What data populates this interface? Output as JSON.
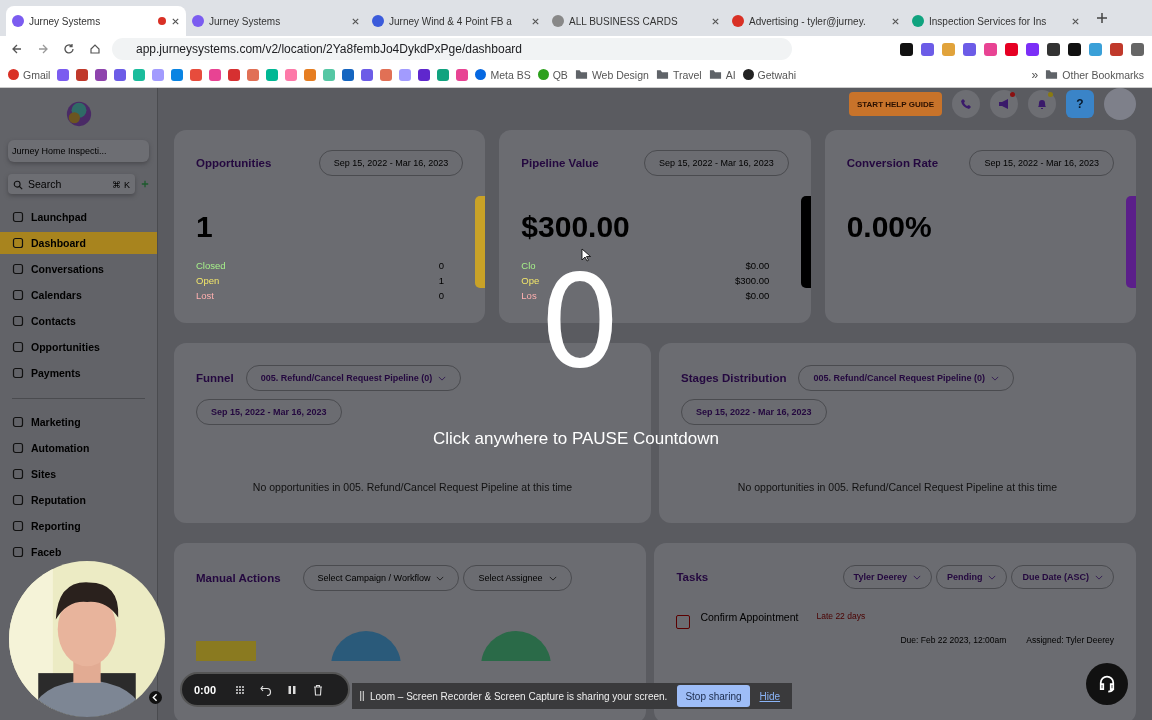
{
  "browser": {
    "tabs": [
      {
        "title": "Jurney Systems",
        "selected": true,
        "recording": true,
        "color": "#7b5cf0"
      },
      {
        "title": "Jurney Systems",
        "selected": false,
        "recording": false,
        "color": "#7b5cf0"
      },
      {
        "title": "Jurney Wind & 4 Point FB a",
        "selected": false,
        "recording": false,
        "color": "#3b5bdb"
      },
      {
        "title": "ALL BUSINESS CARDS",
        "selected": false,
        "recording": false,
        "color": "#888888"
      },
      {
        "title": "Advertising - tyler@jurney.",
        "selected": false,
        "recording": false,
        "color": "#d93025"
      },
      {
        "title": "Inspection Services for Ins",
        "selected": false,
        "recording": false,
        "color": "#10a37f"
      }
    ],
    "url": "app.jurneysystems.com/v2/location/2Ya8fembJo4DykdPxPge/dashboard",
    "extensions": [
      {
        "color": "#111111"
      },
      {
        "color": "#6c5ce7"
      },
      {
        "color": "#e1a33b"
      },
      {
        "color": "#6c5ce7"
      },
      {
        "color": "#e84393"
      },
      {
        "color": "#e60023"
      },
      {
        "color": "#7b2ff7"
      },
      {
        "color": "#333333"
      },
      {
        "color": "#111111"
      },
      {
        "color": "#3aa0d8"
      },
      {
        "color": "#c0392b"
      },
      {
        "color": "#666666"
      }
    ],
    "bookmarks": [
      {
        "kind": "site",
        "label": "Gmail",
        "color": "#d93025"
      },
      {
        "kind": "icon",
        "color": "#7b5cf0"
      },
      {
        "kind": "icon",
        "color": "#c0392b"
      },
      {
        "kind": "icon",
        "color": "#8e44ad"
      },
      {
        "kind": "icon",
        "color": "#6c5ce7"
      },
      {
        "kind": "icon",
        "color": "#1abc9c"
      },
      {
        "kind": "icon",
        "color": "#a29bfe"
      },
      {
        "kind": "icon",
        "color": "#0984e3"
      },
      {
        "kind": "icon",
        "color": "#e74c3c"
      },
      {
        "kind": "icon",
        "color": "#e84393"
      },
      {
        "kind": "icon",
        "color": "#d63031"
      },
      {
        "kind": "icon",
        "color": "#e17055"
      },
      {
        "kind": "icon",
        "color": "#00b894"
      },
      {
        "kind": "icon",
        "color": "#fd79a8"
      },
      {
        "kind": "icon",
        "color": "#e67e22"
      },
      {
        "kind": "icon",
        "color": "#55c7a4"
      },
      {
        "kind": "icon",
        "color": "#1565c0"
      },
      {
        "kind": "icon",
        "color": "#6c5ce7"
      },
      {
        "kind": "icon",
        "color": "#e17055"
      },
      {
        "kind": "icon",
        "color": "#a29bfe"
      },
      {
        "kind": "icon",
        "color": "#5f27cd"
      },
      {
        "kind": "icon",
        "color": "#10a37f"
      },
      {
        "kind": "icon",
        "color": "#e84393"
      },
      {
        "kind": "site",
        "label": "Meta BS",
        "color": "#0668e1"
      },
      {
        "kind": "site",
        "label": "QB",
        "color": "#2ca01c"
      },
      {
        "kind": "folder",
        "label": "Web Design",
        "color": "#5f6368"
      },
      {
        "kind": "folder",
        "label": "Travel",
        "color": "#5f6368"
      },
      {
        "kind": "folder",
        "label": "AI",
        "color": "#5f6368"
      },
      {
        "kind": "site",
        "label": "Getwahi",
        "color": "#222222"
      }
    ],
    "more": "»",
    "other_bookmarks": "Other Bookmarks"
  },
  "sidebar": {
    "account": "Jurney Home Inspecti...",
    "search": {
      "placeholder": "Search",
      "shortcut": "⌘ K"
    },
    "groups": [
      [
        {
          "label": "Launchpad",
          "selected": false
        },
        {
          "label": "Dashboard",
          "selected": true
        },
        {
          "label": "Conversations",
          "selected": false
        },
        {
          "label": "Calendars",
          "selected": false
        },
        {
          "label": "Contacts",
          "selected": false
        },
        {
          "label": "Opportunities",
          "selected": false
        },
        {
          "label": "Payments",
          "selected": false
        }
      ],
      [
        {
          "label": "Marketing",
          "selected": false
        },
        {
          "label": "Automation",
          "selected": false
        },
        {
          "label": "Sites",
          "selected": false
        },
        {
          "label": "Reputation",
          "selected": false
        },
        {
          "label": "Reporting",
          "selected": false
        },
        {
          "label": "Faceb",
          "selected": false
        }
      ]
    ]
  },
  "header": {
    "help_guide": "START HELP GUIDE",
    "help": "?"
  },
  "stat_cards": [
    {
      "title": "Opportunities",
      "date_range": "Sep 15, 2022 - Mar 16, 2023",
      "value": "1",
      "color": "#c9a227",
      "breakdown": [
        {
          "label": "Closed",
          "value": "0"
        },
        {
          "label": "Open",
          "value": "1"
        },
        {
          "label": "Lost",
          "value": "0"
        }
      ]
    },
    {
      "title": "Pipeline Value",
      "date_range": "Sep 15, 2022 - Mar 16, 2023",
      "value": "$300.00",
      "color": "#000000",
      "breakdown": [
        {
          "label": "Clo",
          "value": "$0.00"
        },
        {
          "label": "Ope",
          "value": "$300.00"
        },
        {
          "label": "Los",
          "value": "$0.00"
        }
      ]
    },
    {
      "title": "Conversion Rate",
      "date_range": "Sep 15, 2022 - Mar 16, 2023",
      "value": "0.00%",
      "color": "#5b1f8a"
    }
  ],
  "pipeline_cards": [
    {
      "title": "Funnel",
      "pipeline": "005. Refund/Cancel Request Pipeline (0)",
      "date_range": "Sep 15, 2022 - Mar 16, 2023",
      "empty": "No opportunities in 005. Refund/Cancel Request Pipeline at this time"
    },
    {
      "title": "Stages Distribution",
      "pipeline": "005. Refund/Cancel Request Pipeline (0)",
      "date_range": "Sep 15, 2022 - Mar 16, 2023",
      "empty": "No opportunities in 005. Refund/Cancel Request Pipeline at this time"
    }
  ],
  "manual_actions": {
    "title": "Manual Actions",
    "filters": [
      "Select Campaign / Workflow",
      "Select Assignee"
    ]
  },
  "tasks": {
    "title": "Tasks",
    "filters": [
      "Tyler Deerey",
      "Pending",
      "Due Date (ASC)"
    ],
    "items": [
      {
        "checked": false,
        "title": "Confirm Appointment",
        "late": "Late 22 days",
        "due": "Due: Feb 22 2023, 12:00am",
        "assigned": "Assigned: Tyler Deerey"
      }
    ]
  },
  "countdown": {
    "number": "0",
    "hint": "Click anywhere to PAUSE Countdown"
  },
  "loom": {
    "timer": "0:00",
    "message": "Loom – Screen Recorder & Screen Capture is sharing your screen.",
    "stop": "Stop sharing",
    "hide": "Hide"
  }
}
